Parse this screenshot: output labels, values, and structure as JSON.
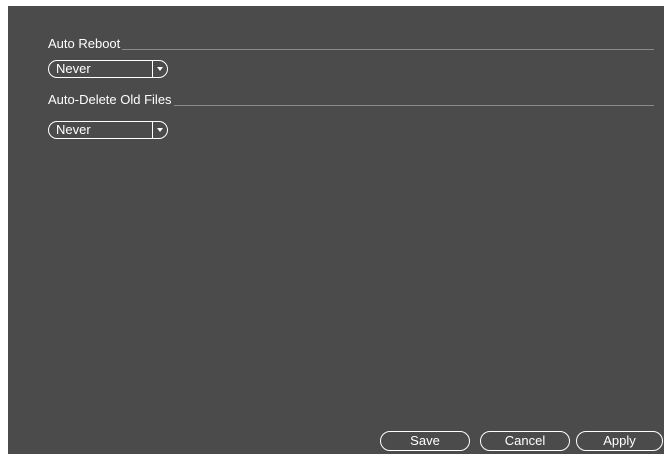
{
  "settings": {
    "auto_reboot": {
      "title": "Auto Reboot",
      "value": "Never"
    },
    "auto_delete": {
      "title": "Auto-Delete Old Files",
      "value": "Never"
    }
  },
  "footer": {
    "save_label": "Save",
    "cancel_label": "Cancel",
    "apply_label": "Apply"
  },
  "icons": {
    "dropdown": "chevron-down-icon"
  },
  "colors": {
    "background": "#4b4b4b",
    "text": "#ffffff",
    "divider": "#8a8a8a"
  }
}
